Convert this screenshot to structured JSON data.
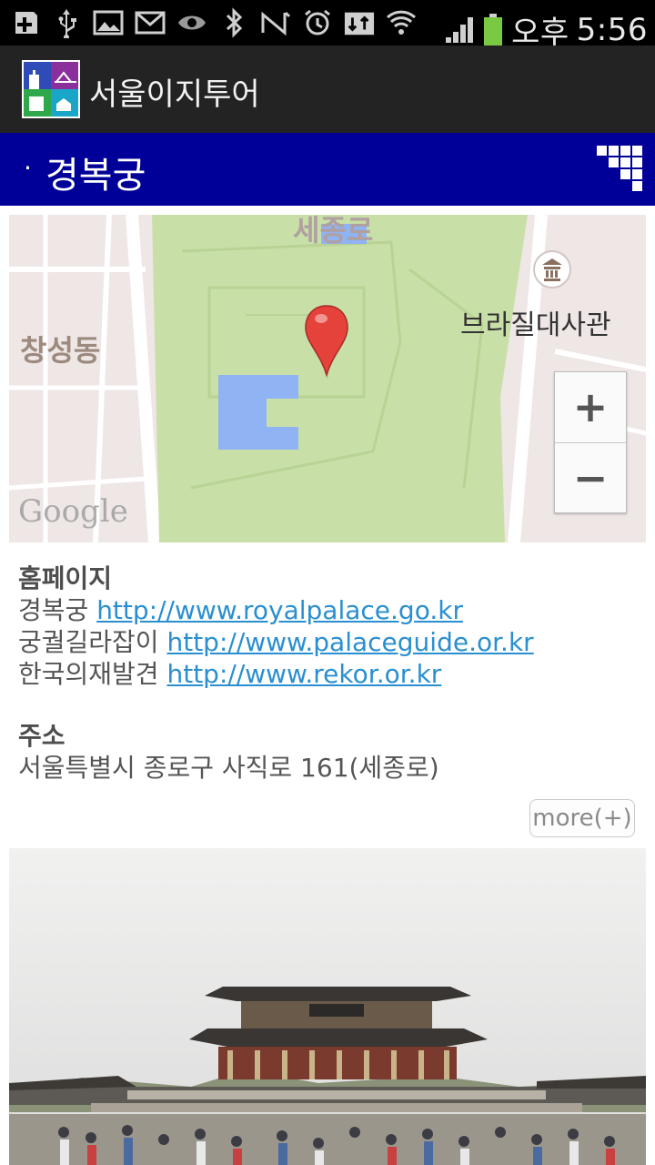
{
  "status_bar": {
    "ampm": "오후",
    "time": "5:56",
    "icons": [
      "add-icon",
      "usb-icon",
      "image-icon",
      "mail-icon",
      "eye-icon",
      "bluetooth-icon",
      "nfc-icon",
      "alarm-icon",
      "data-icon",
      "wifi-icon",
      "signal-icon",
      "battery-icon"
    ]
  },
  "app": {
    "title": "서울이지투어"
  },
  "page": {
    "dot": "·",
    "title": "경복궁"
  },
  "map": {
    "labels": {
      "top": "세종로",
      "left": "창성동",
      "embassy": "브라질대사관",
      "google": "Google"
    },
    "zoom_in": "+",
    "zoom_out": "−"
  },
  "info": {
    "homepage_label": "홈페이지",
    "links": [
      {
        "name": "경복궁",
        "url": "http://www.royalpalace.go.kr"
      },
      {
        "name": "궁궐길라잡이",
        "url": "http://www.palaceguide.or.kr"
      },
      {
        "name": "한국의재발견",
        "url": "http://www.rekor.or.kr"
      }
    ],
    "address_label": "주소",
    "address": "서울특별시 종로구 사직로 161(세종로)",
    "more_label": "more(+)"
  },
  "colors": {
    "title_strip": "#000099",
    "action_bar": "#232323",
    "link": "#2a8fd0",
    "map_park": "#c9dfa8",
    "map_water": "#8fb3f3"
  }
}
